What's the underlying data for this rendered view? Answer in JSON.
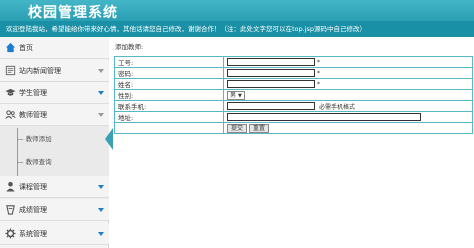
{
  "header": {
    "title": "校园管理系统",
    "notice": "欢迎登陆我站，希望能给你带来好心情，其他话请您自己修改，谢谢合作！（注：此处文字您可以在top.jsp源码中自己修改）"
  },
  "sidebar": {
    "items": [
      {
        "label": "首页",
        "icon": "home-icon"
      },
      {
        "label": "站内新闻管理",
        "icon": "news-icon"
      },
      {
        "label": "学生管理",
        "icon": "graduation-cap-icon"
      },
      {
        "label": "教师管理",
        "icon": "teacher-icon"
      },
      {
        "label": "课程管理",
        "icon": "user-icon"
      },
      {
        "label": "成绩管理",
        "icon": "score-icon"
      },
      {
        "label": "系统管理",
        "icon": "gear-icon"
      }
    ],
    "submenu": [
      {
        "label": "教师添加",
        "active": true
      },
      {
        "label": "教师查询",
        "active": false
      }
    ]
  },
  "form": {
    "title": "添加教师:",
    "fields": [
      {
        "label": "工号:",
        "required": "*"
      },
      {
        "label": "密码:",
        "required": "*"
      },
      {
        "label": "姓名:",
        "required": "*"
      },
      {
        "label": "性别:",
        "value": "男"
      },
      {
        "label": "联系手机:",
        "hint": "必需手机格式"
      },
      {
        "label": "地址:"
      }
    ],
    "submit_label": "提交",
    "reset_label": "重置"
  },
  "colors": {
    "header": "#2b9fb3",
    "notice_bar": "#1a90a6",
    "table_border": "#57b8c8",
    "nav_accent": "#1e7ecb"
  }
}
